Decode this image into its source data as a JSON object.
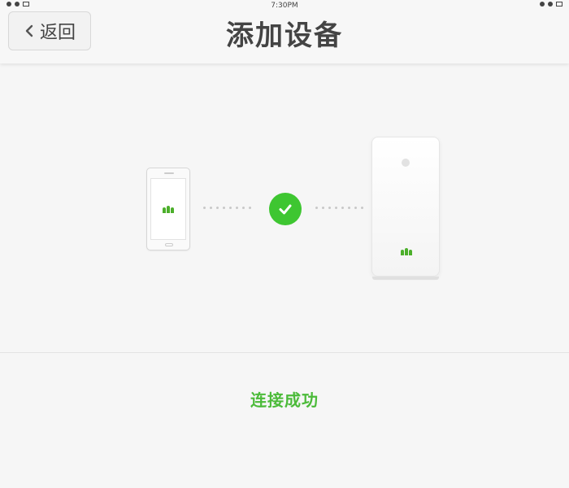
{
  "status_bar": {
    "time": "7:30PM"
  },
  "nav": {
    "back_label": "返回",
    "title": "添加设备"
  },
  "result": {
    "message": "连接成功",
    "color": "#4cbb3a"
  },
  "icons": {
    "back": "chevron-left-icon",
    "success": "checkmark-icon",
    "phone": "phone-icon",
    "router": "router-icon"
  },
  "colors": {
    "accent": "#3ec631",
    "nav_background": "#f7f7f7",
    "page_background": "#f6f6f6"
  }
}
